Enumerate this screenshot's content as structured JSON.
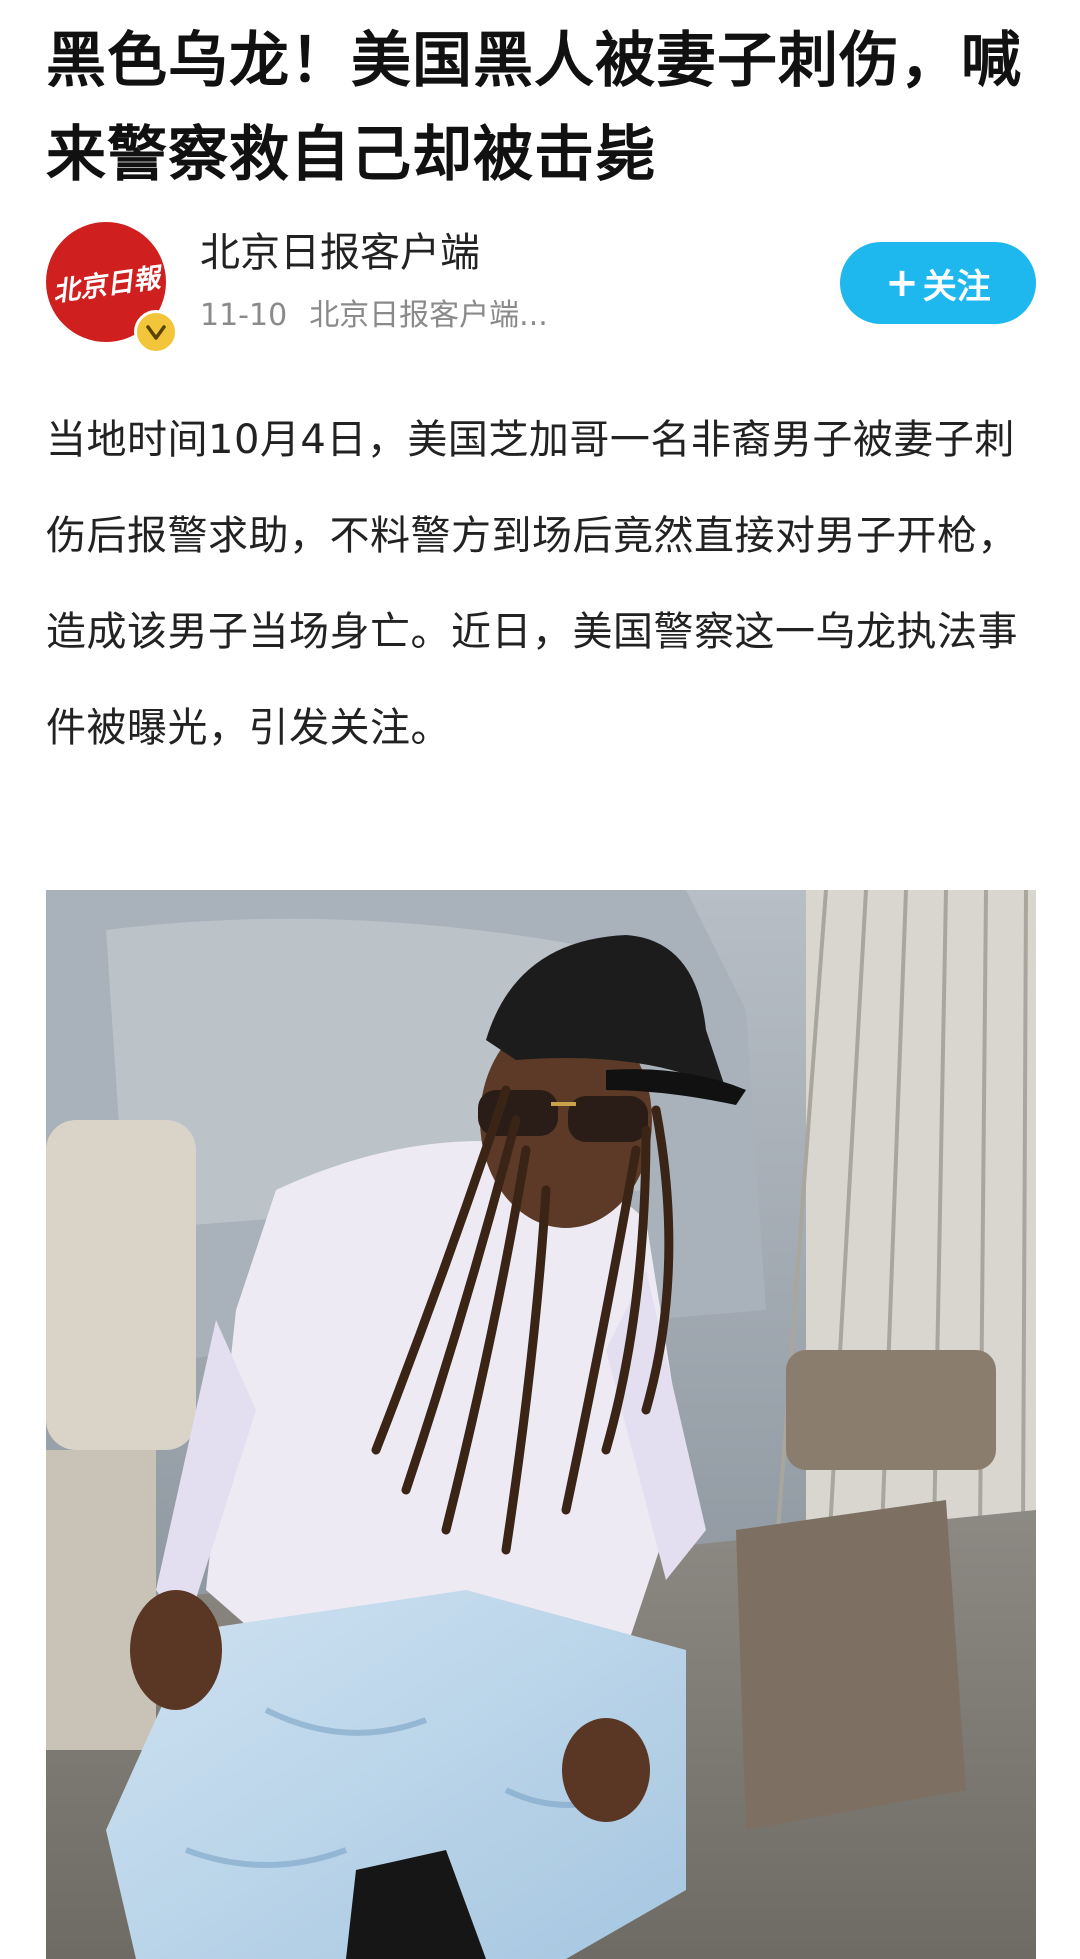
{
  "article": {
    "title": "黑色乌龙！美国黑人被妻子刺伤，喊来警察救自己却被击毙",
    "body": "当地时间10月4日，美国芝加哥一名非裔男子被妻子刺伤后报警求助，不料警方到场后竟然直接对男子开枪，造成该男子当场身亡。近日，美国警察这一乌龙执法事件被曝光，引发关注。"
  },
  "author": {
    "name": "北京日报客户端",
    "date": "11-10",
    "source": "北京日报客户端...",
    "avatar_logo_text": "北京日報",
    "avatar_color": "#d01f1f",
    "verified_badge_icon": "verified-v-icon",
    "verified_badge_color": "#f3c53a"
  },
  "follow": {
    "plus": "+",
    "label": "关注",
    "color": "#1fb8ee"
  }
}
